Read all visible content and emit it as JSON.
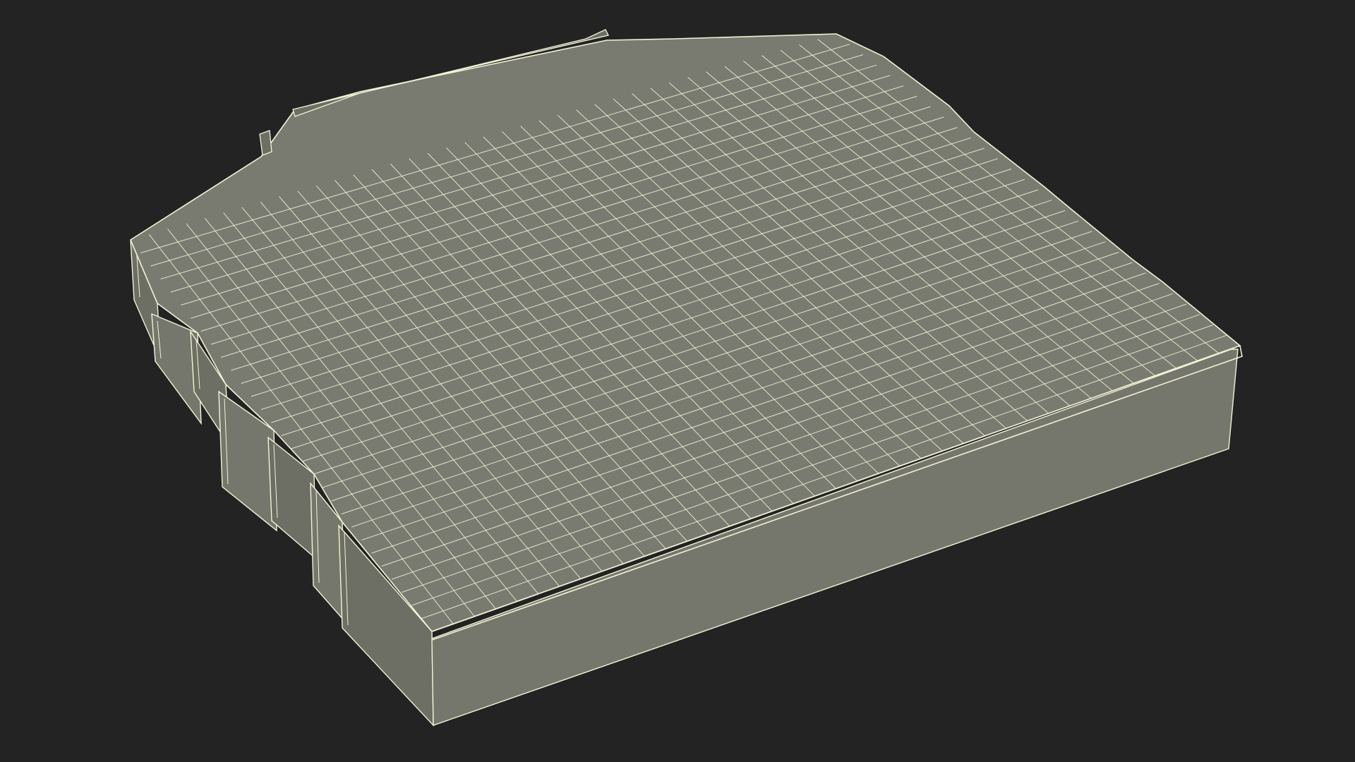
{
  "scene": {
    "subject": "wireframe-building-model",
    "background_color": "#232323",
    "surface_color": "#7a7b70",
    "side_color": "#76776c",
    "dark_side_color": "#6d6e64",
    "wire_color": "#f3f3d8"
  }
}
